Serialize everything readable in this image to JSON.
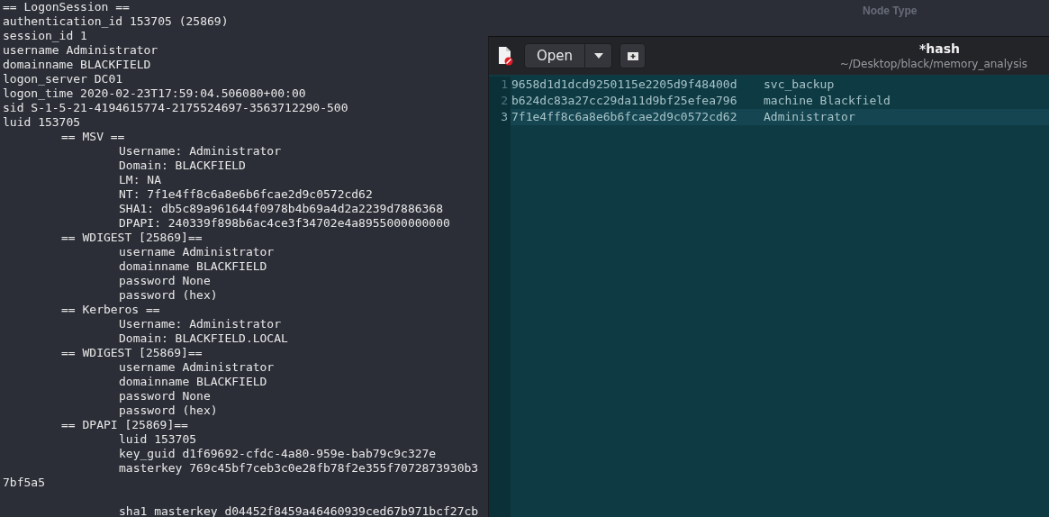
{
  "background": {
    "column_header": "Node Type"
  },
  "terminal": {
    "header": "== LogonSession ==",
    "fields": [
      "authentication_id 153705 (25869)",
      "session_id 1",
      "username Administrator",
      "domainname BLACKFIELD",
      "logon_server DC01",
      "logon_time 2020-02-23T17:59:04.506080+00:00",
      "sid S-1-5-21-4194615774-2175524697-3563712290-500",
      "luid 153705"
    ],
    "sections": [
      {
        "title": "== MSV ==",
        "entries": [
          {
            "text": "Username: Administrator"
          },
          {
            "text": "Domain: BLACKFIELD"
          },
          {
            "text": "LM: NA"
          },
          {
            "text": "NT: 7f1e4ff8c6a8e6b6fcae2d9c0572cd62"
          },
          {
            "text": "SHA1: db5c89a961644f0978b4b69a4d2a2239d7886368"
          },
          {
            "text": "DPAPI: 240339f898b6ac4ce3f34702e4a8955000000000"
          }
        ]
      },
      {
        "title": "== WDIGEST [25869]==",
        "entries": [
          {
            "text": "username Administrator"
          },
          {
            "text": "domainname BLACKFIELD"
          },
          {
            "text": "password None"
          },
          {
            "text": "password (hex)"
          }
        ]
      },
      {
        "title": "== Kerberos ==",
        "entries": [
          {
            "text": "Username: Administrator"
          },
          {
            "text": "Domain: BLACKFIELD.LOCAL"
          }
        ]
      },
      {
        "title": "== WDIGEST [25869]==",
        "entries": [
          {
            "text": "username Administrator"
          },
          {
            "text": "domainname BLACKFIELD"
          },
          {
            "text": "password None"
          },
          {
            "text": "password (hex)"
          }
        ]
      },
      {
        "title": "== DPAPI [25869]==",
        "entries": [
          {
            "text": "luid 153705"
          },
          {
            "text": "key_guid d1f69692-cfdc-4a80-959e-bab79c9c327e"
          },
          {
            "text": "masterkey 769c45bf7ceb3c0e28fb78f2e355f7072873930b3",
            "wrap": "7bf5a5"
          },
          {
            "text": "sha1_masterkey d04452f8459a46460939ced67b971bcf27cb"
          }
        ]
      }
    ]
  },
  "editor": {
    "open_button": "Open",
    "title": "*hash",
    "path": "~/Desktop/black/memory_analysis",
    "lines": [
      {
        "number": "1",
        "hash": "9658d1d1dcd9250115e2205d9f48400d",
        "name": "svc_backup",
        "current": false
      },
      {
        "number": "2",
        "hash": "b624dc83a27cc29da11d9bf25efea796",
        "name": "machine Blackfield",
        "current": false
      },
      {
        "number": "3",
        "hash": "7f1e4ff8c6a8e6b6fcae2d9c0572cd62",
        "name": "Administrator",
        "current": true
      }
    ]
  }
}
